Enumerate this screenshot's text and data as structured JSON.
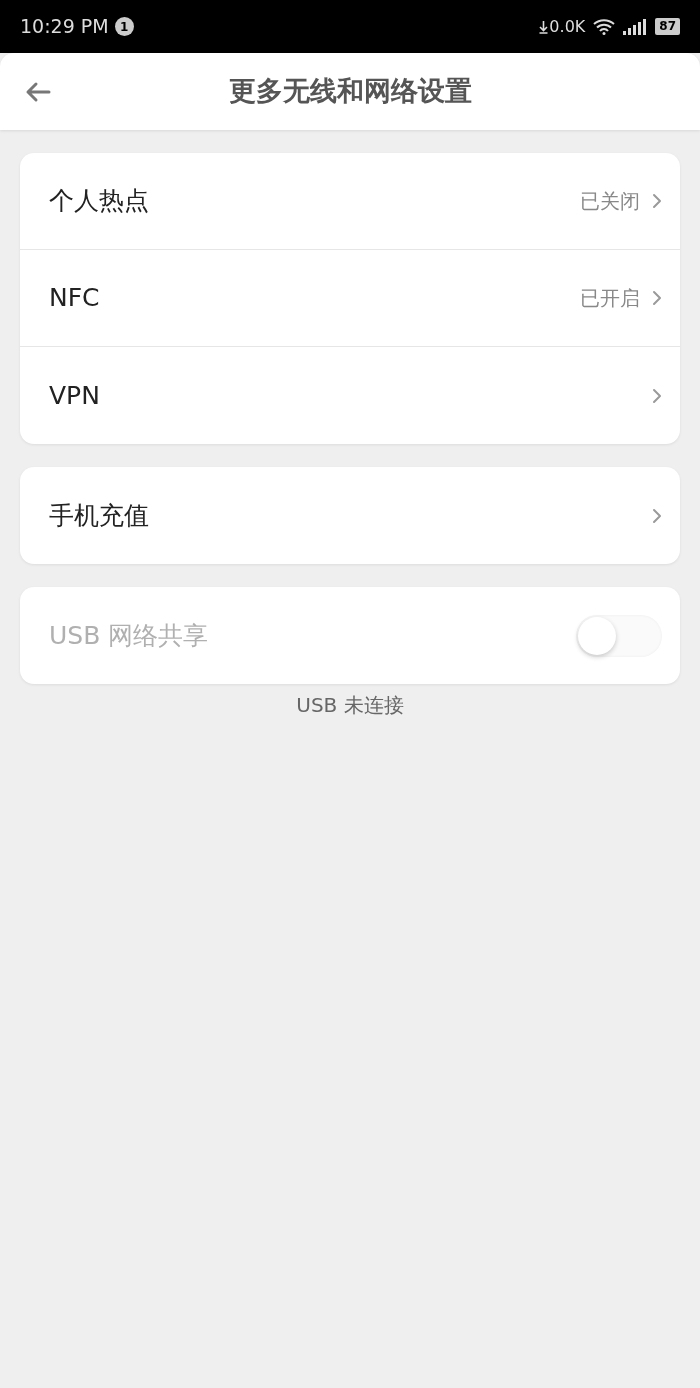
{
  "status_bar": {
    "time": "10:29 PM",
    "notification_count": "1",
    "net_speed": "0.0K",
    "battery": "87"
  },
  "header": {
    "title": "更多无线和网络设置"
  },
  "groups": [
    {
      "items": [
        {
          "kind": "link",
          "label": "个人热点",
          "value": "已关闭"
        },
        {
          "kind": "link",
          "label": "NFC",
          "value": "已开启"
        },
        {
          "kind": "link",
          "label": "VPN"
        }
      ]
    },
    {
      "items": [
        {
          "kind": "link",
          "label": "手机充值"
        }
      ]
    },
    {
      "items": [
        {
          "kind": "toggle",
          "label": "USB 网络共享",
          "on": false,
          "disabled": true
        }
      ],
      "footnote": "USB 未连接"
    }
  ]
}
